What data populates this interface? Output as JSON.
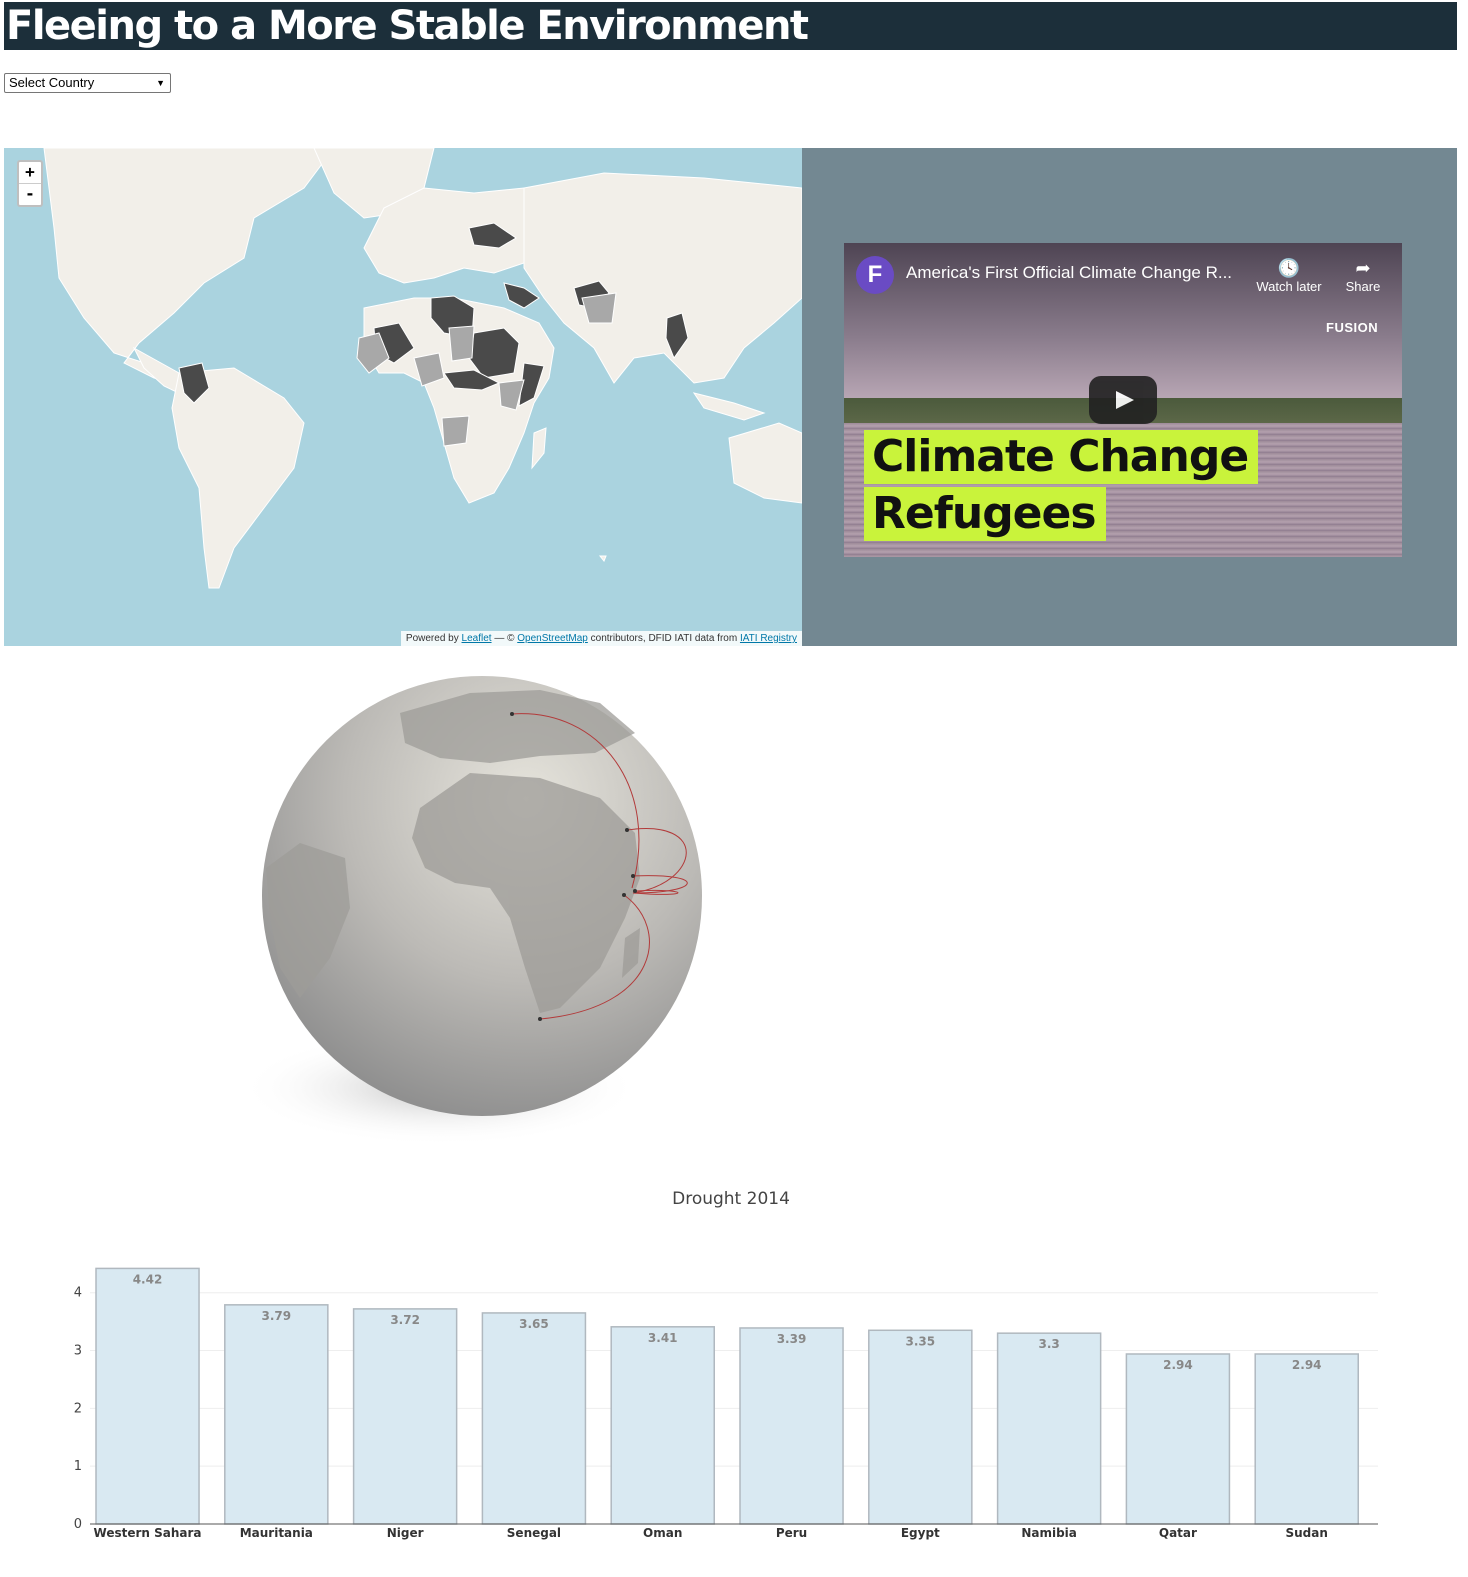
{
  "header": {
    "title": "Fleeing to a More Stable Environment"
  },
  "country_select": {
    "selected": "Select Country"
  },
  "map": {
    "zoom_in": "+",
    "zoom_out": "-",
    "attribution": {
      "prefix": "Powered by ",
      "leaflet": "Leaflet",
      "mid": " — © ",
      "osm": "OpenStreetMap",
      "mid2": " contributors, DFID IATI data from ",
      "iati": "IATI Registry"
    }
  },
  "video": {
    "title": "America's First Official Climate Change R...",
    "watch_later": "Watch later",
    "share": "Share",
    "channel": "FUSION",
    "headline_1": "Climate Change",
    "headline_2": "Refugees"
  },
  "chart_data": {
    "type": "bar",
    "title": "Drought 2014",
    "categories": [
      "Western Sahara",
      "Mauritania",
      "Niger",
      "Senegal",
      "Oman",
      "Peru",
      "Egypt",
      "Namibia",
      "Qatar",
      "Sudan"
    ],
    "values": [
      4.42,
      3.79,
      3.72,
      3.65,
      3.41,
      3.39,
      3.35,
      3.3,
      2.94,
      2.94
    ],
    "ylim": [
      0,
      4.6
    ],
    "yticks": [
      0,
      1,
      2,
      3,
      4
    ],
    "bar_color": "#d9e9f2",
    "bar_border": "#b0b8bf"
  }
}
